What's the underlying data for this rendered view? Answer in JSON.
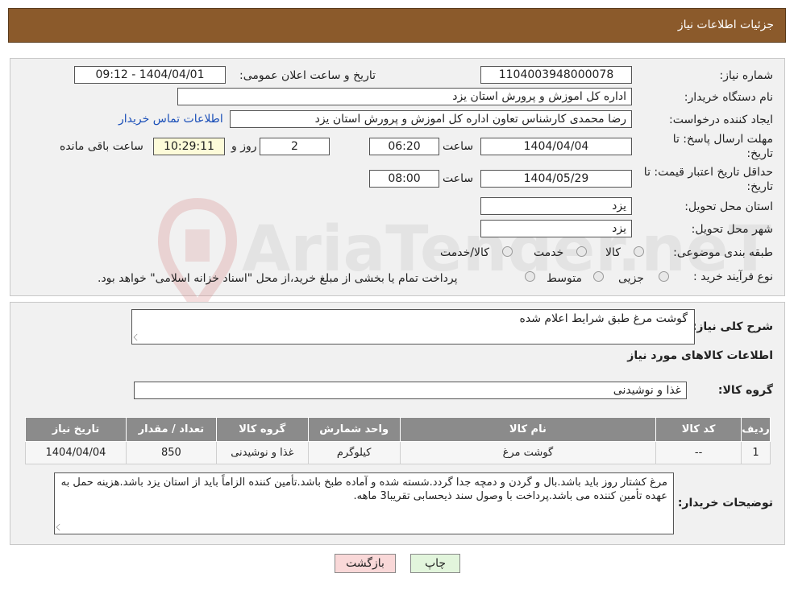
{
  "header": {
    "title": "جزئیات اطلاعات نیاز"
  },
  "form": {
    "need_number_label": "شماره نیاز:",
    "need_number": "1104003948000078",
    "announce_label": "تاریخ و ساعت اعلان عمومی:",
    "announce_value": "1404/04/01 - 09:12",
    "buyer_org_label": "نام دستگاه خریدار:",
    "buyer_org": "اداره کل اموزش و پرورش استان یزد",
    "creator_label": "ایجاد کننده درخواست:",
    "creator": "رضا محمدی کارشناس تعاون اداره کل اموزش و پرورش استان یزد",
    "contact_link": "اطلاعات تماس خریدار",
    "deadline_label_1": "مهلت ارسال پاسخ: تا",
    "deadline_label_2": "تاریخ:",
    "deadline_date": "1404/04/04",
    "time_label": "ساعت",
    "deadline_time": "06:20",
    "days_value": "2",
    "days_label": "روز و",
    "remaining_time": "10:29:11",
    "remaining_label": "ساعت باقی مانده",
    "validity_label_1": "حداقل تاریخ اعتبار قیمت: تا",
    "validity_label_2": "تاریخ:",
    "validity_date": "1404/05/29",
    "validity_time": "08:00",
    "province_label": "استان محل تحویل:",
    "province": "یزد",
    "city_label": "شهر محل تحویل:",
    "city": "یزد",
    "category_label": "طبقه بندی موضوعی:",
    "category_options": [
      "کالا",
      "خدمت",
      "کالا/خدمت"
    ],
    "process_label": "نوع فرآیند خرید :",
    "process_options": [
      "جزیی",
      "متوسط"
    ],
    "process_note": "پرداخت تمام یا بخشی از مبلغ خرید،از محل \"اسناد خزانه اسلامی\" خواهد بود."
  },
  "watermark": "AriaTender.neT",
  "summary": {
    "desc_label": "شرح کلی نیاز:",
    "desc_value": "گوشت مرغ طبق شرایط اعلام شده",
    "goods_title": "اطلاعات کالاهای مورد نیاز",
    "group_label": "گروه کالا:",
    "group_value": "غذا و نوشیدنی"
  },
  "table": {
    "headers": [
      "ردیف",
      "کد کالا",
      "نام کالا",
      "واحد شمارش",
      "گروه کالا",
      "تعداد / مقدار",
      "تاریخ نیاز"
    ],
    "rows": [
      [
        "1",
        "--",
        "گوشت مرغ",
        "کیلوگرم",
        "غذا و نوشیدنی",
        "850",
        "1404/04/04"
      ]
    ]
  },
  "notes": {
    "label": "توضیحات خریدار:",
    "text": "مرغ کشتار روز باید باشد.بال و گردن و دمچه جدا گردد.شسته شده و آماده طبخ باشد.تأمین کننده الزاماً باید از استان یزد باشد.هزینه حمل به عهده تأمین کننده می باشد.پرداخت با وصول سند ذیحسابی تقریبا3 ماهه."
  },
  "buttons": {
    "print": "چاپ",
    "back": "بازگشت"
  },
  "colors": {
    "header": "#8b5a2b",
    "table_header": "#8b8b8b",
    "back_button": "#f9d8d8",
    "print_button": "#e2f5dc"
  }
}
